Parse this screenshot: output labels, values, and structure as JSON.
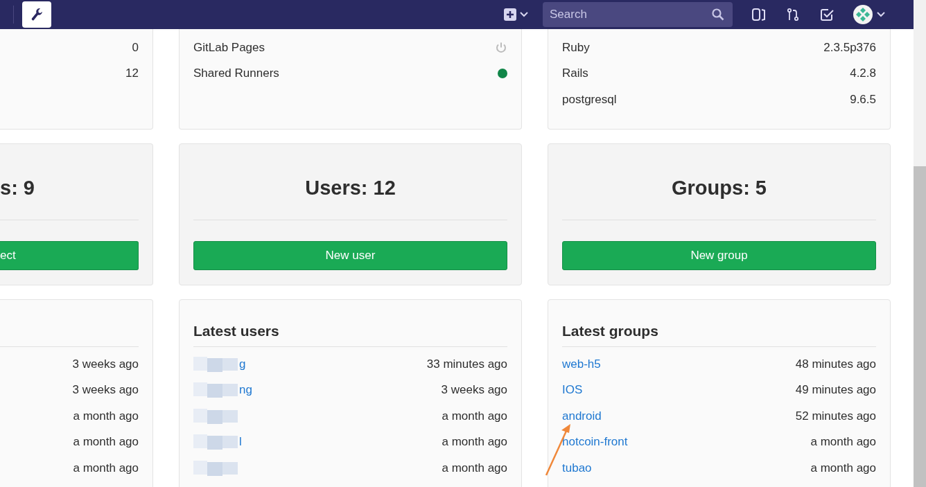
{
  "navbar": {
    "search": {
      "placeholder": "Search"
    }
  },
  "stats_cut": {
    "values": [
      "0",
      "12"
    ]
  },
  "features": [
    {
      "label": "GitLab Pages",
      "on": false
    },
    {
      "label": "Shared Runners",
      "on": true
    }
  ],
  "components": [
    {
      "name": "Ruby",
      "version": "2.3.5p376"
    },
    {
      "name": "Rails",
      "version": "4.2.8"
    },
    {
      "name": "postgresql",
      "version": "9.6.5"
    }
  ],
  "counters": [
    {
      "title": "s: 9",
      "button": "ect"
    },
    {
      "title": "Users: 12",
      "button": "New user"
    },
    {
      "title": "Groups: 5",
      "button": "New group"
    }
  ],
  "latest_projects_cut": {
    "times": [
      "3 weeks ago",
      "3 weeks ago",
      "a month ago",
      "a month ago",
      "a month ago"
    ]
  },
  "latest_users": {
    "title": "Latest users",
    "rows": [
      {
        "name": "g",
        "redacted": true,
        "time": "33 minutes ago"
      },
      {
        "name": "ng",
        "redacted": true,
        "time": "3 weeks ago"
      },
      {
        "redacted": true,
        "time": "a month ago"
      },
      {
        "name": "l",
        "redacted": true,
        "time": "a month ago"
      },
      {
        "redacted": true,
        "time": "a month ago"
      }
    ]
  },
  "latest_groups": {
    "title": "Latest groups",
    "rows": [
      {
        "name": "web-h5",
        "time": "48 minutes ago"
      },
      {
        "name": "IOS",
        "time": "49 minutes ago"
      },
      {
        "name": "android",
        "time": "52 minutes ago"
      },
      {
        "name": "hotcoin-front",
        "time": "a month ago"
      },
      {
        "name": "tubao",
        "time": "a month ago"
      }
    ]
  }
}
